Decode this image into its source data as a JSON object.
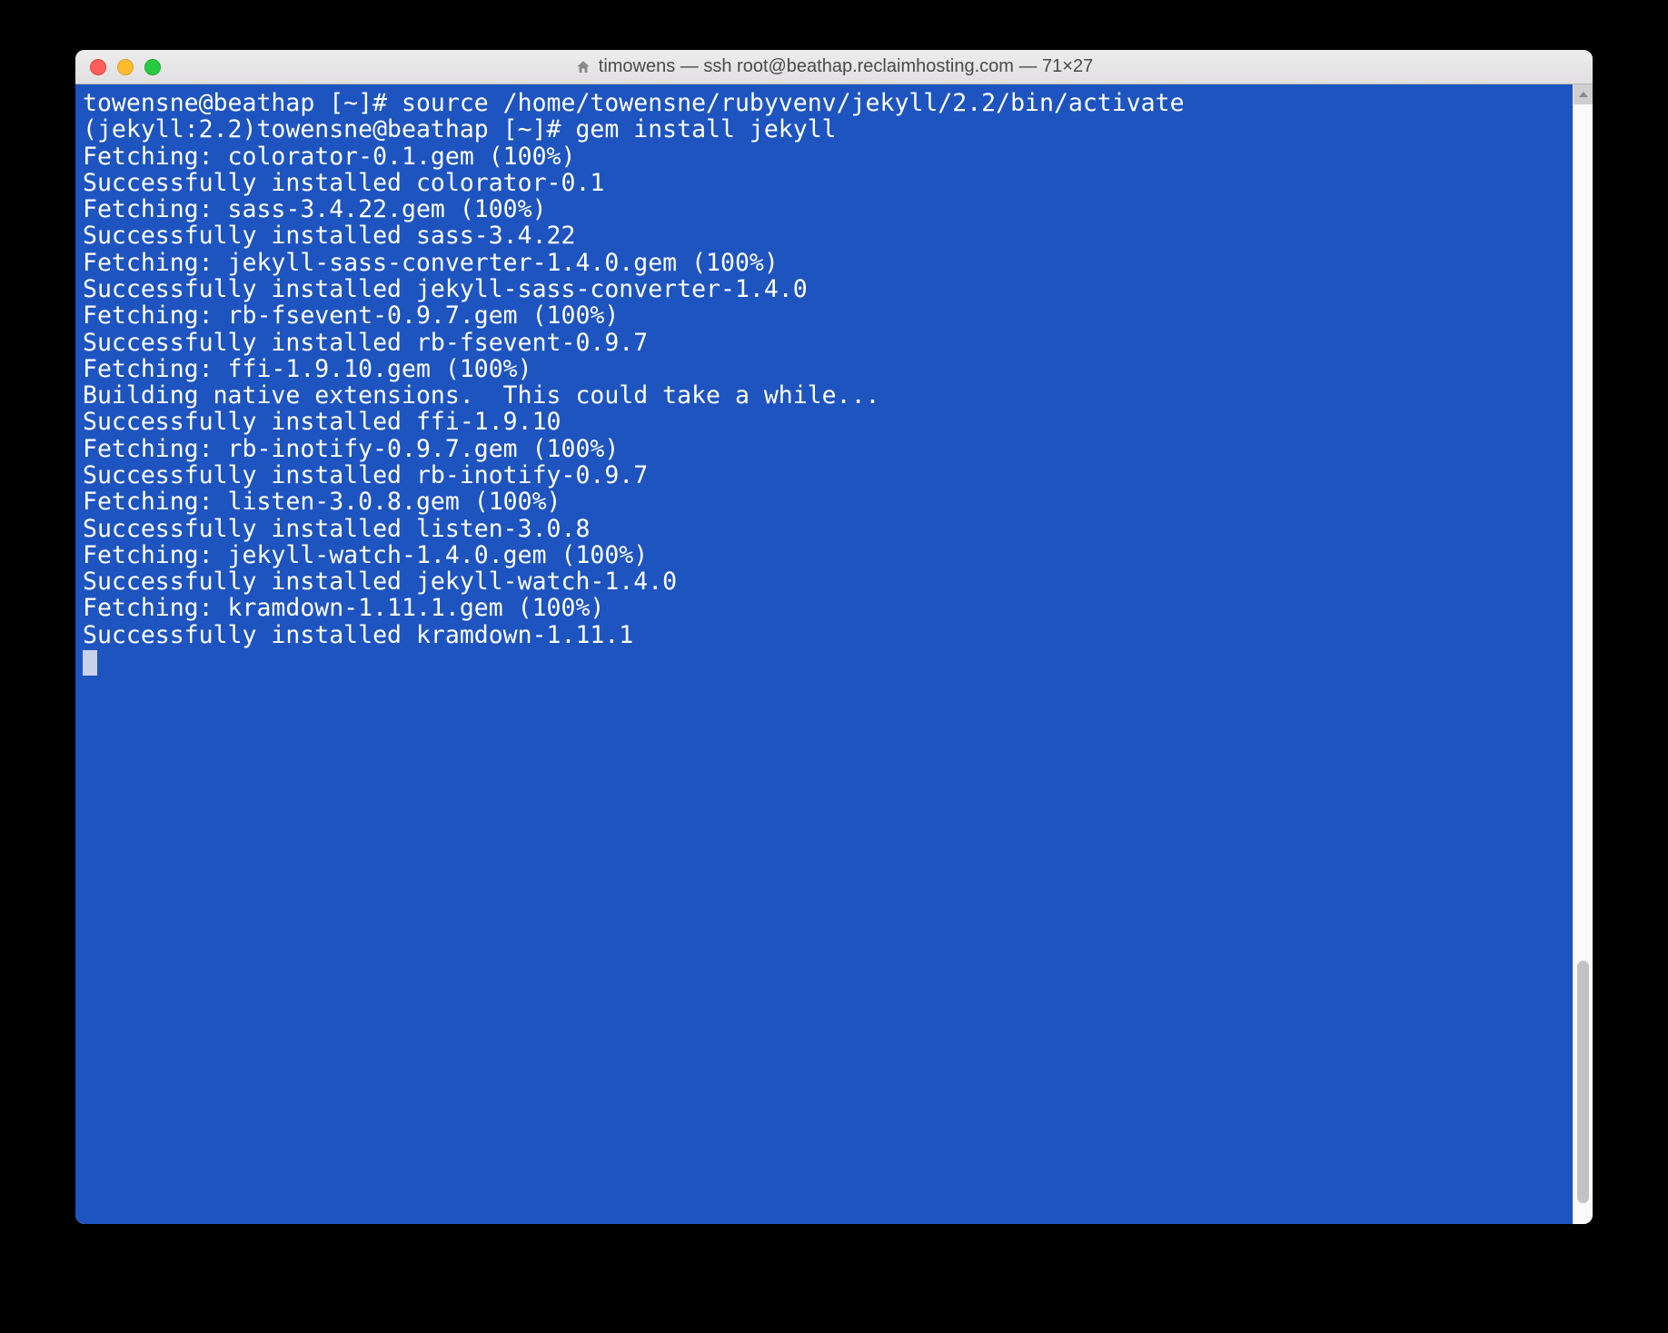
{
  "titlebar": {
    "title": "timowens — ssh root@beathap.reclaimhosting.com — 71×27"
  },
  "terminal": {
    "lines": [
      "towensne@beathap [~]# source /home/towensne/rubyvenv/jekyll/2.2/bin/activate",
      "(jekyll:2.2)towensne@beathap [~]# gem install jekyll",
      "Fetching: colorator-0.1.gem (100%)",
      "Successfully installed colorator-0.1",
      "Fetching: sass-3.4.22.gem (100%)",
      "Successfully installed sass-3.4.22",
      "Fetching: jekyll-sass-converter-1.4.0.gem (100%)",
      "Successfully installed jekyll-sass-converter-1.4.0",
      "Fetching: rb-fsevent-0.9.7.gem (100%)",
      "Successfully installed rb-fsevent-0.9.7",
      "Fetching: ffi-1.9.10.gem (100%)",
      "Building native extensions.  This could take a while...",
      "Successfully installed ffi-1.9.10",
      "Fetching: rb-inotify-0.9.7.gem (100%)",
      "Successfully installed rb-inotify-0.9.7",
      "Fetching: listen-3.0.8.gem (100%)",
      "Successfully installed listen-3.0.8",
      "Fetching: jekyll-watch-1.4.0.gem (100%)",
      "Successfully installed jekyll-watch-1.4.0",
      "Fetching: kramdown-1.11.1.gem (100%)",
      "Successfully installed kramdown-1.11.1"
    ]
  }
}
